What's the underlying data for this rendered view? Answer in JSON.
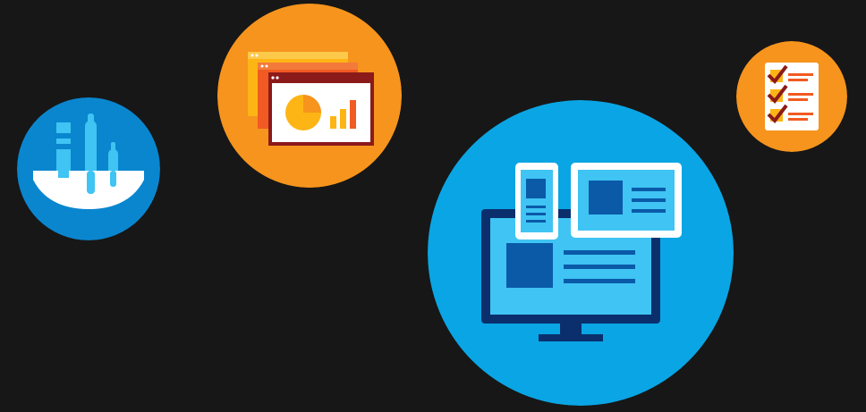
{
  "colors": {
    "background": "#171717",
    "blue": "#0a86cf",
    "sky": "#0aa5e4",
    "light_blue": "#3fc4f3",
    "navy": "#0a2f6c",
    "orange": "#f6941d",
    "deep_orange": "#f15a22",
    "yellow": "#fdb515",
    "maroon": "#8b1a1a",
    "white": "#ffffff"
  },
  "badges": [
    {
      "id": "tools",
      "icon": "tools-cup-icon"
    },
    {
      "id": "reports",
      "icon": "report-windows-icon"
    },
    {
      "id": "devices",
      "icon": "multi-device-icon"
    },
    {
      "id": "checklist",
      "icon": "checklist-icon"
    }
  ]
}
